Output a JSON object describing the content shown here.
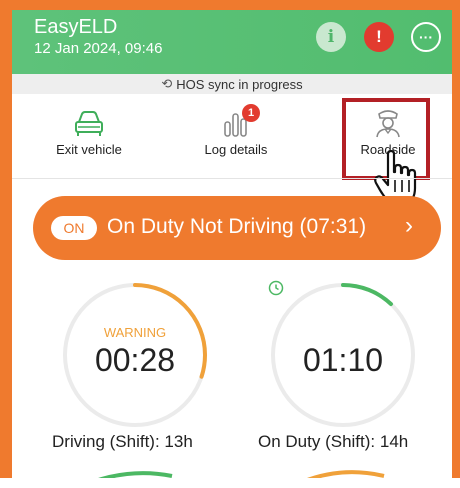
{
  "header": {
    "app_name": "EasyELD",
    "datetime": "12 Jan 2024, 09:46",
    "info_glyph": "i",
    "alert_glyph": "!",
    "more_glyph": "···",
    "colors": {
      "header_green": "#52bd6f",
      "alert_red": "#e23b2f"
    }
  },
  "sync_banner": {
    "text": "HOS sync in progress",
    "icon": "sync-icon"
  },
  "quick_actions": [
    {
      "label": "Exit vehicle",
      "icon": "car-icon"
    },
    {
      "label": "Log details",
      "icon": "bar-chart-icon",
      "badge": "1"
    },
    {
      "label": "Roadside",
      "icon": "officer-icon",
      "highlighted": true
    }
  ],
  "status": {
    "chip": "ON",
    "text": "On Duty Not Driving (07:31)",
    "color": "#ef7a2e"
  },
  "gauges": [
    {
      "status_label": "WARNING",
      "time": "00:28",
      "caption": "Driving (Shift): 13h",
      "progress": 0.3,
      "color": "#f0a13a"
    },
    {
      "status_label": "",
      "time": "01:10",
      "caption": "On Duty (Shift): 14h",
      "progress": 0.12,
      "color": "#4cb863",
      "icon": "clock-icon"
    }
  ]
}
